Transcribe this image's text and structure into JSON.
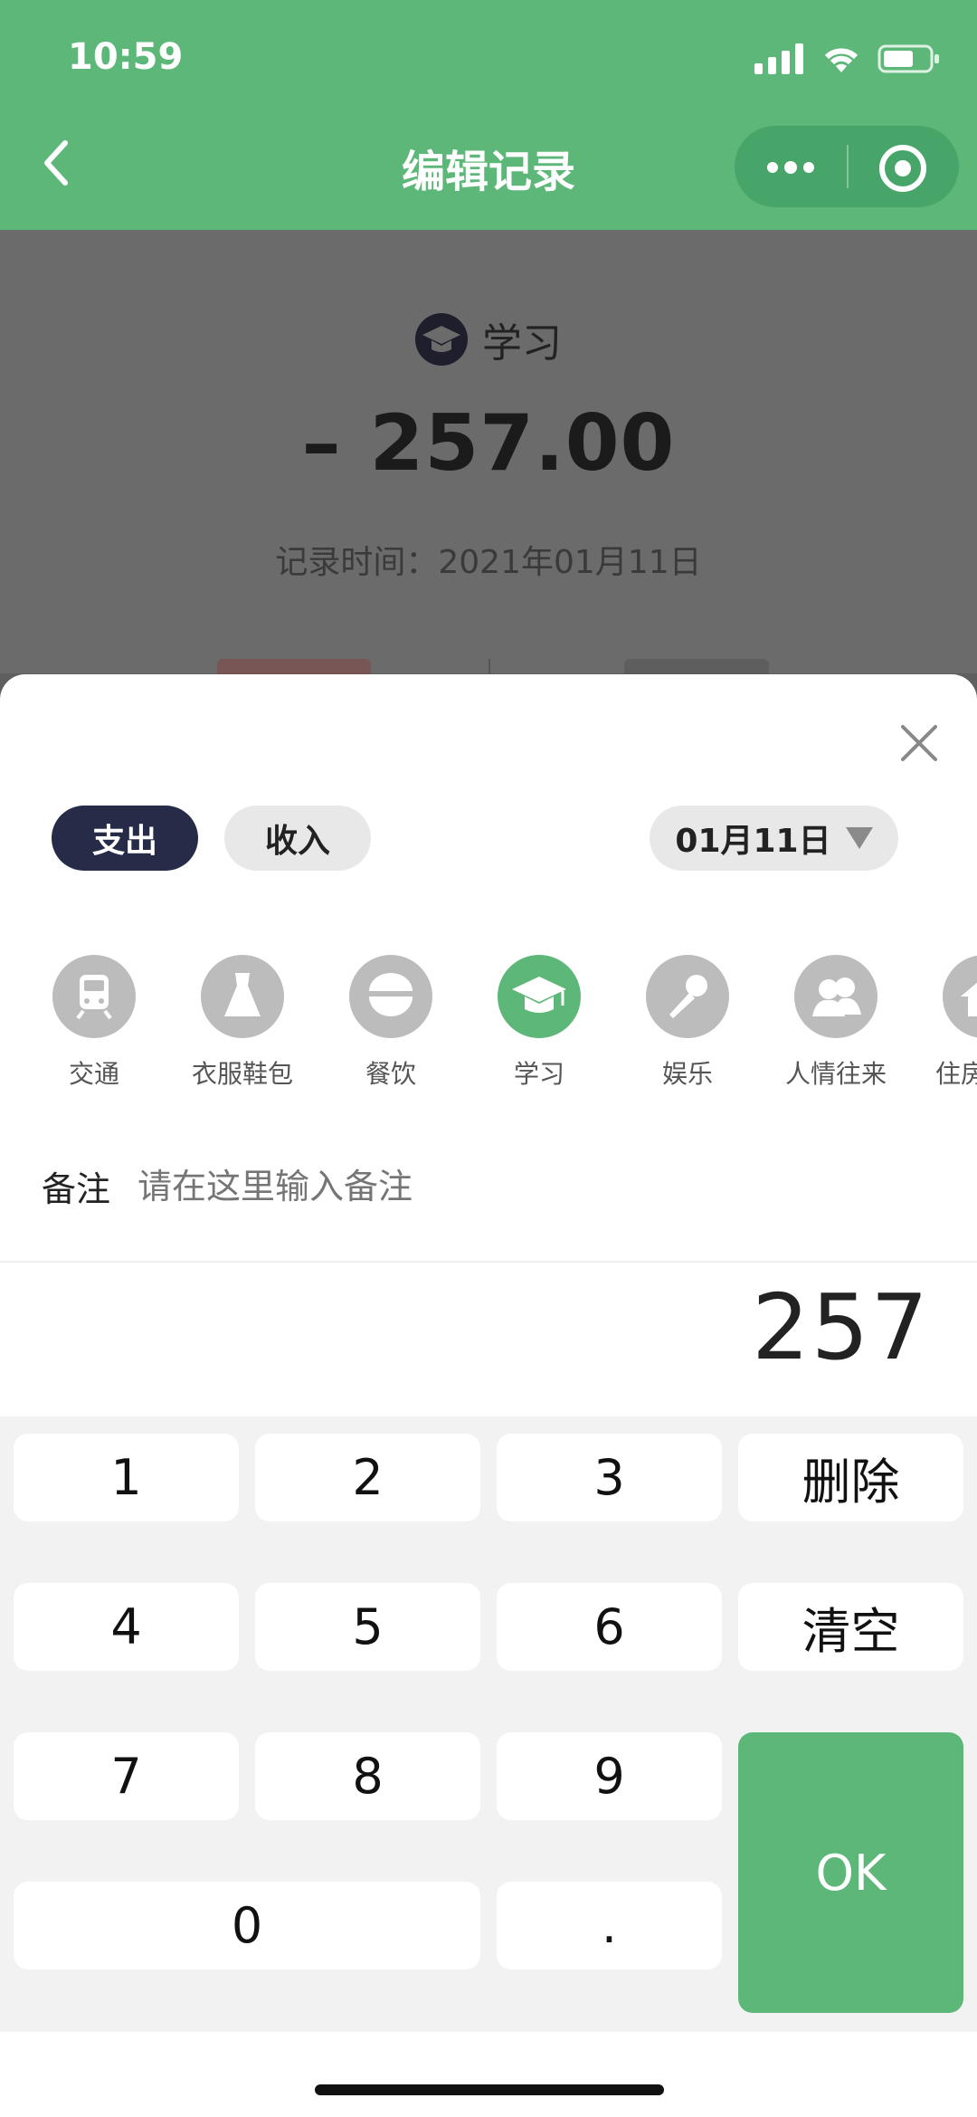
{
  "status_bar": {
    "time": "10:59",
    "signal_icon": "signal-icon",
    "wifi_icon": "wifi-icon",
    "battery_icon": "battery-icon"
  },
  "nav": {
    "title": "编辑记录",
    "back_icon": "back-arrow-icon",
    "more_icon": "more-dots-icon",
    "target_icon": "target-icon"
  },
  "record_card": {
    "category": "学习",
    "category_icon": "graduation-cap-icon",
    "amount": "– 257.00",
    "time_text": "记录时间：2021年01月11日"
  },
  "sheet": {
    "close_icon": "close-icon",
    "tabs": [
      {
        "label": "支出",
        "active": true
      },
      {
        "label": "收入",
        "active": false
      }
    ],
    "date": "01月11日",
    "categories": [
      {
        "label": "交通",
        "icon": "train-icon",
        "active": false
      },
      {
        "label": "衣服鞋包",
        "icon": "dress-icon",
        "active": false
      },
      {
        "label": "餐饮",
        "icon": "bowl-icon",
        "active": false
      },
      {
        "label": "学习",
        "icon": "graduation-cap-icon",
        "active": true
      },
      {
        "label": "娱乐",
        "icon": "microphone-icon",
        "active": false
      },
      {
        "label": "人情往来",
        "icon": "people-icon",
        "active": false
      },
      {
        "label": "住房",
        "icon": "house-icon",
        "active": false
      }
    ],
    "note": {
      "label": "备注",
      "placeholder": "请在这里输入备注"
    }
  },
  "display": {
    "value": "257"
  },
  "keypad": {
    "k1": "1",
    "k2": "2",
    "k3": "3",
    "delete": "删除",
    "k4": "4",
    "k5": "5",
    "k6": "6",
    "clear": "清空",
    "k7": "7",
    "k8": "8",
    "k9": "9",
    "ok": "OK",
    "k0": "0",
    "dot": "."
  },
  "colors": {
    "accent": "#5db778",
    "dark_tab": "#262b47"
  }
}
